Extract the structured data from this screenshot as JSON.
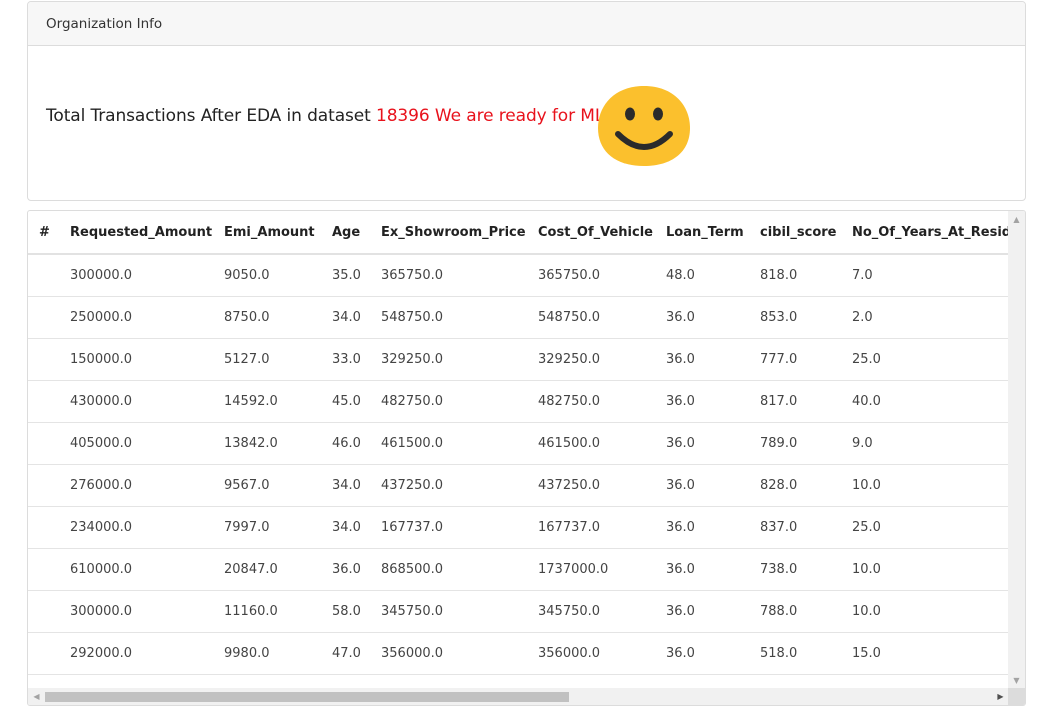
{
  "card": {
    "header": "Organization Info",
    "headline_prefix": "Total Transactions After EDA in dataset ",
    "count": "18396",
    "ready_text": " We are ready for ML",
    "emoji_icon": "smiley-face-icon"
  },
  "table": {
    "columns": [
      "#",
      "Requested_Amount",
      "Emi_Amount",
      "Age",
      "Ex_Showroom_Price",
      "Cost_Of_Vehicle",
      "Loan_Term",
      "cibil_score",
      "No_Of_Years_At_Reside"
    ],
    "rows": [
      [
        "",
        "300000.0",
        "9050.0",
        "35.0",
        "365750.0",
        "365750.0",
        "48.0",
        "818.0",
        "7.0"
      ],
      [
        "",
        "250000.0",
        "8750.0",
        "34.0",
        "548750.0",
        "548750.0",
        "36.0",
        "853.0",
        "2.0"
      ],
      [
        "",
        "150000.0",
        "5127.0",
        "33.0",
        "329250.0",
        "329250.0",
        "36.0",
        "777.0",
        "25.0"
      ],
      [
        "",
        "430000.0",
        "14592.0",
        "45.0",
        "482750.0",
        "482750.0",
        "36.0",
        "817.0",
        "40.0"
      ],
      [
        "",
        "405000.0",
        "13842.0",
        "46.0",
        "461500.0",
        "461500.0",
        "36.0",
        "789.0",
        "9.0"
      ],
      [
        "",
        "276000.0",
        "9567.0",
        "34.0",
        "437250.0",
        "437250.0",
        "36.0",
        "828.0",
        "10.0"
      ],
      [
        "",
        "234000.0",
        "7997.0",
        "34.0",
        "167737.0",
        "167737.0",
        "36.0",
        "837.0",
        "25.0"
      ],
      [
        "",
        "610000.0",
        "20847.0",
        "36.0",
        "868500.0",
        "1737000.0",
        "36.0",
        "738.0",
        "10.0"
      ],
      [
        "",
        "300000.0",
        "11160.0",
        "58.0",
        "345750.0",
        "345750.0",
        "36.0",
        "788.0",
        "10.0"
      ],
      [
        "",
        "292000.0",
        "9980.0",
        "47.0",
        "356000.0",
        "356000.0",
        "36.0",
        "518.0",
        "15.0"
      ]
    ]
  },
  "colors": {
    "accent_red": "#e8121c",
    "emoji_yellow": "#fbc02d",
    "header_bg": "#f7f7f7"
  }
}
